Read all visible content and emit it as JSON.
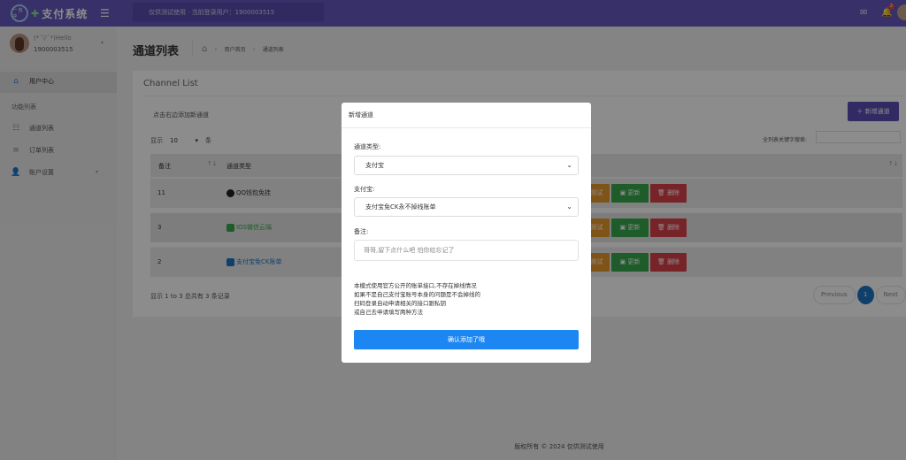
{
  "header": {
    "logo_small": "一 包 冲",
    "logo_text": "支付系统",
    "notice": "仅供测试使用 · 当前登录用户：1900003515",
    "badge": "2"
  },
  "sidebar": {
    "user_name": "(*´▽`*)Hello",
    "user_id": "1900003515",
    "home": "用户中心",
    "section": "功能列表",
    "items": [
      {
        "label": "通道列表"
      },
      {
        "label": "订单列表"
      },
      {
        "label": "账户设置"
      }
    ]
  },
  "page": {
    "title": "通道列表",
    "breadcrumb": [
      "用户首页",
      "通道列表"
    ]
  },
  "card": {
    "title": "Channel List",
    "hint": "点击右边添加新通道",
    "add_button": "新增通道",
    "show_prefix": "显示",
    "page_size": "10",
    "show_suffix": "条",
    "search_label": "全列表关键字搜索:",
    "columns": [
      "备注",
      "通道类型"
    ],
    "rows": [
      {
        "note": "11",
        "type": "QQ钱包免挂",
        "color": "#333333"
      },
      {
        "note": "3",
        "type": "IOS微信云端",
        "color": "#37a84b"
      },
      {
        "note": "2",
        "type": "支付宝免CK账单",
        "color": "#1d74c4"
      }
    ],
    "btn_test": "测试",
    "btn_update": "更新",
    "btn_delete": "删除",
    "info": "显示 1 to 3 总共有 3 条记录",
    "pager": {
      "prev": "Previous",
      "current": "1",
      "next": "Next"
    }
  },
  "footer": "版权所有 © 2024 仅供测试使用",
  "modal": {
    "title": "新增通道",
    "type_label": "通道类型:",
    "type_value": "支付宝",
    "pay_label": "支付宝:",
    "pay_value": "支付宝免CK永不掉线账单",
    "note_label": "备注:",
    "note_placeholder": "哥哥,留下点什么吧 怕你给忘记了",
    "notes": [
      "本模式使用官方公开的账单接口,不存在掉线情况",
      "如果不是自己支付宝账号本身的问题是不会掉线的",
      "扫码登录自动申请相关的接口跟私钥",
      "或自己去申请填写两种方法"
    ],
    "confirm": "确认添加了哦"
  },
  "colors": {
    "accent": "#6658c0",
    "primary": "#1c86f2"
  }
}
